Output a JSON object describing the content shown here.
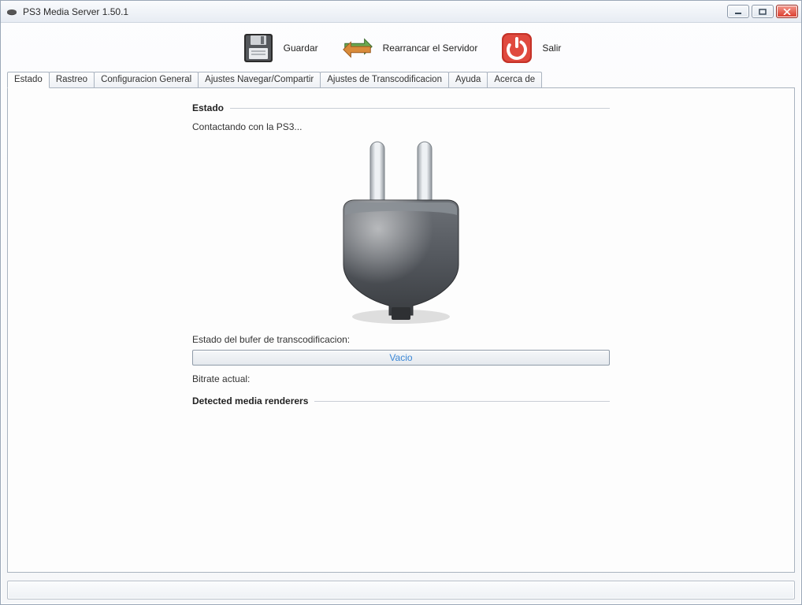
{
  "window": {
    "title": "PS3 Media Server 1.50.1"
  },
  "toolbar": {
    "save": {
      "label": "Guardar"
    },
    "restart": {
      "label": "Rearrancar el Servidor"
    },
    "quit": {
      "label": "Salir"
    }
  },
  "tabs": [
    {
      "label": "Estado"
    },
    {
      "label": "Rastreo"
    },
    {
      "label": "Configuracion General"
    },
    {
      "label": "Ajustes Navegar/Compartir"
    },
    {
      "label": "Ajustes de Transcodificacion"
    },
    {
      "label": "Ayuda"
    },
    {
      "label": "Acerca de"
    }
  ],
  "status": {
    "section_label": "Estado",
    "contacting": "Contactando con la PS3...",
    "buffer_label": "Estado del bufer de transcodificacion:",
    "buffer_value": "Vacio",
    "bitrate_label": "Bitrate actual:",
    "renderers_label": "Detected media renderers"
  }
}
